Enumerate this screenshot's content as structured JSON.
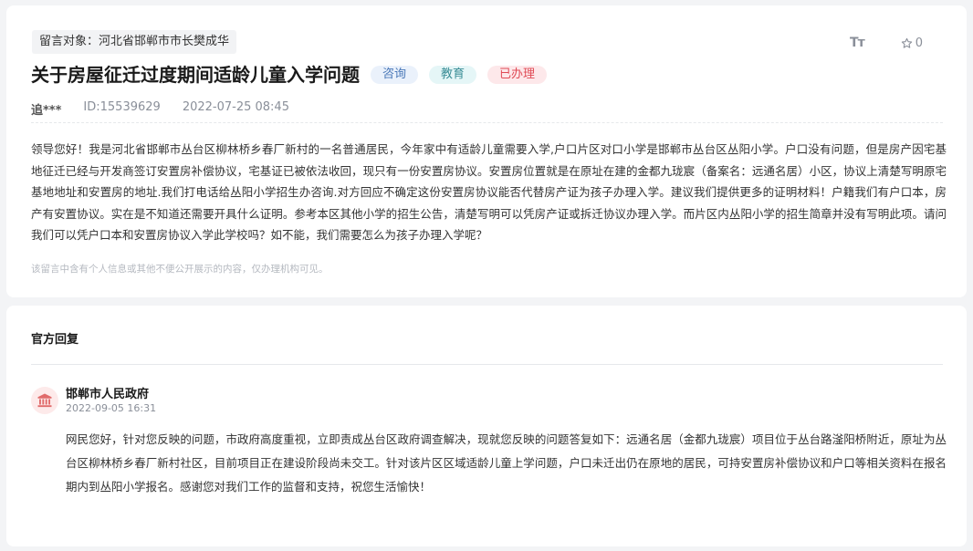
{
  "message": {
    "target": "留言对象：河北省邯郸市市长樊成华",
    "tools": {
      "font_icon_text": "Tт",
      "star_count": "0"
    },
    "title": "关于房屋征迁过度期间适龄儿童入学问题",
    "tags": [
      "咨询",
      "教育",
      "已办理"
    ],
    "author": "追***",
    "id": "ID:15539629",
    "datetime": "2022-07-25 08:45",
    "content": "领导您好！我是河北省邯郸市丛台区柳林桥乡春厂新村的一名普通居民，今年家中有适龄儿童需要入学,户口片区对口小学是邯郸市丛台区丛阳小学。户口没有问题，但是房产因宅基地征迁已经与开发商签订安置房补偿协议，宅基证已被依法收回，现只有一份安置房协议。安置房位置就是在原址在建的金都九珑宸（备案名：远通名居）小区，协议上清楚写明原宅基地地址和安置房的地址.我们打电话给丛阳小学招生办咨询.对方回应不确定这份安置房协议能否代替房产证为孩子办理入学。建议我们提供更多的证明材料！户籍我们有户口本，房产有安置协议。实在是不知道还需要开具什么证明。参考本区其他小学的招生公告，清楚写明可以凭房产证或拆迁协议办理入学。而片区内丛阳小学的招生简章并没有写明此项。请问我们可以凭户口本和安置房协议入学此学校吗？如不能，我们需要怎么为孩子办理入学呢？",
    "notice": "该留言中含有个人信息或其他不便公开展示的内容，仅办理机构可见。"
  },
  "reply": {
    "heading": "官方回复",
    "org_name": "邯郸市人民政府",
    "org_time": "2022-09-05 16:31",
    "content": "网民您好，针对您反映的问题，市政府高度重视，立即责成丛台区政府调查解决，现就您反映的问题答复如下：远通名居（金都九珑宸）项目位于丛台路滏阳桥附近，原址为丛台区柳林桥乡春厂新村社区，目前项目正在建设阶段尚未交工。针对该片区区域适龄儿童上学问题，户口未迁出仍在原地的居民，可持安置房补偿协议和户口等相关资料在报名期内到丛阳小学报名。感谢您对我们工作的监督和支持，祝您生活愉快！"
  },
  "colors": {
    "badge_consult": "#4a78b8",
    "badge_edu": "#3a8d96",
    "badge_done": "#e04a55",
    "org_icon": "#e06a6a"
  },
  "icons": [
    "font-size-icon",
    "star-icon",
    "government-building-icon"
  ]
}
